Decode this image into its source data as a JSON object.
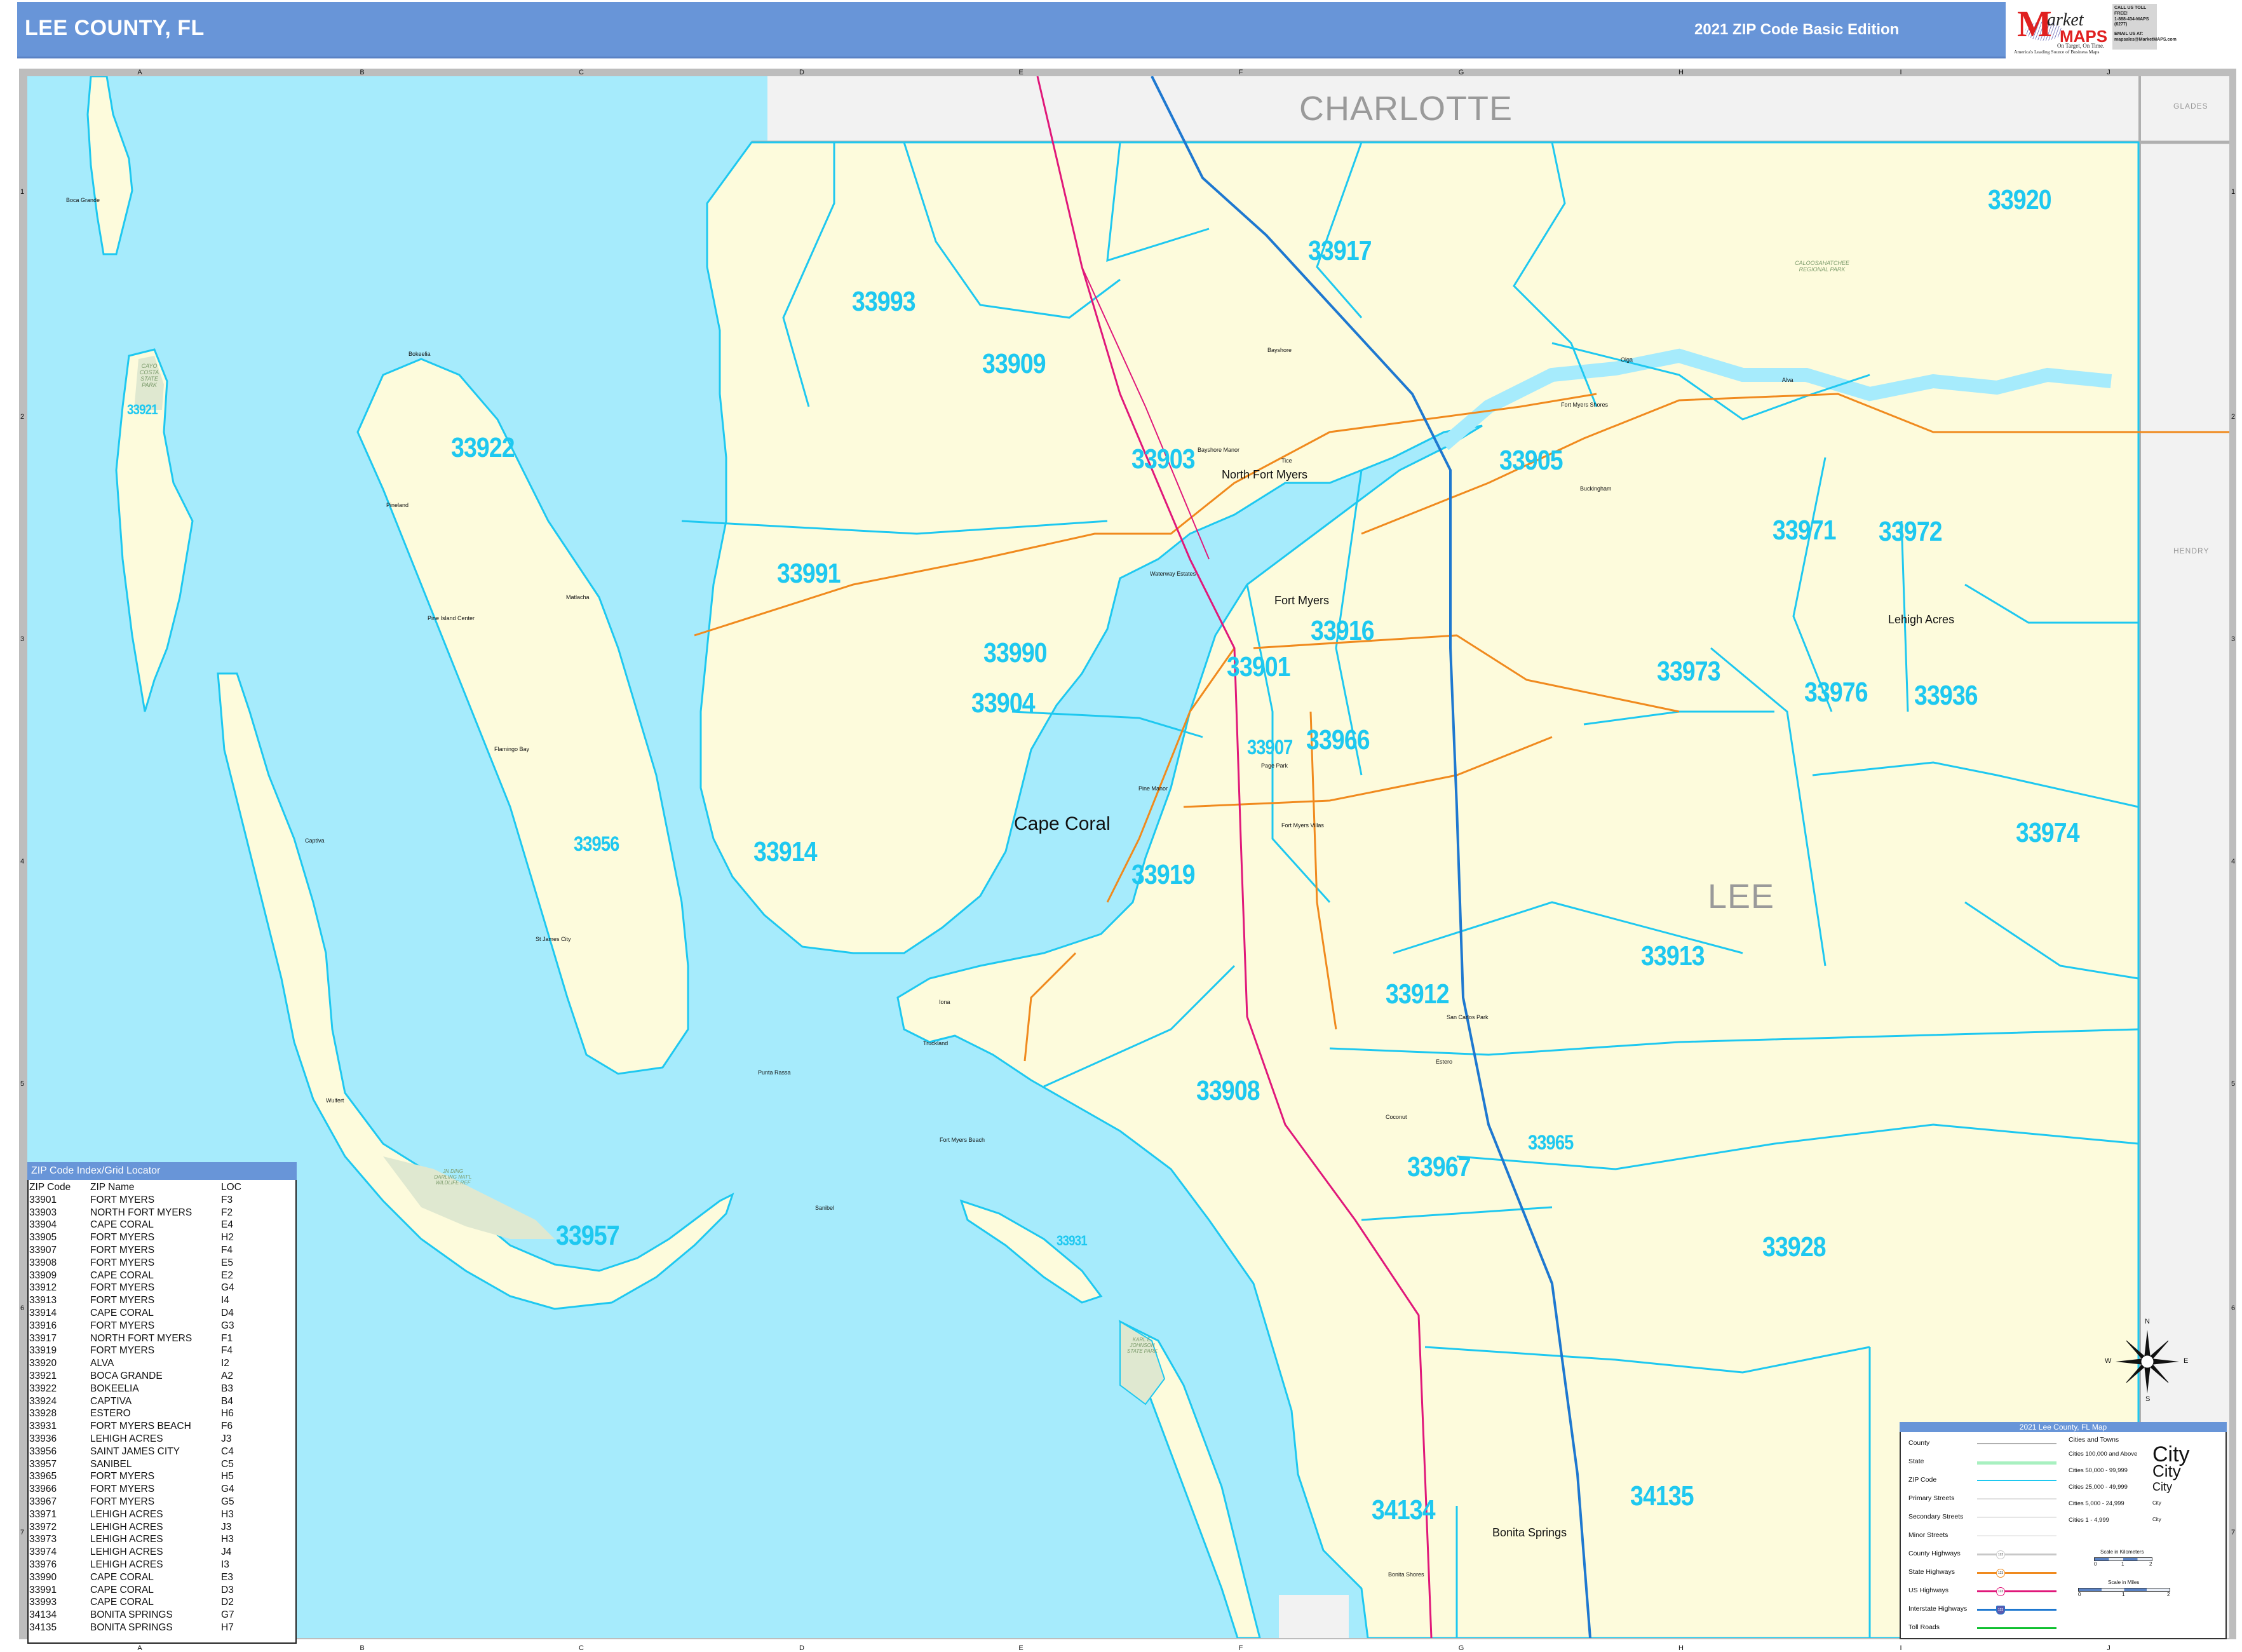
{
  "header": {
    "title": "LEE COUNTY, FL",
    "edition": "2021 ZIP Code Basic Edition"
  },
  "logo": {
    "m": "M",
    "arket": "arket",
    "maps": "MAPS",
    "tagline": "On Target, On Time.",
    "slogan": "America's Leading Source of Business Maps",
    "contact_line1": "CALL US TOLL FREE!",
    "contact_line2": "1-888-434-MAPS (6277)",
    "contact_line3": "EMAIL US AT:",
    "contact_line4": "mapsales@MarketMAPS.com"
  },
  "grid": {
    "columns": [
      "A",
      "B",
      "C",
      "D",
      "E",
      "F",
      "G",
      "H",
      "I",
      "J"
    ],
    "rows": [
      "1",
      "2",
      "3",
      "4",
      "5",
      "6",
      "7"
    ]
  },
  "counties": {
    "main": "LEE",
    "north": "CHARLOTTE",
    "northeast": "GLADES",
    "east": "HENDRY"
  },
  "zip_labels": [
    {
      "zip": "33920"
    },
    {
      "zip": "33917"
    },
    {
      "zip": "33993"
    },
    {
      "zip": "33909"
    },
    {
      "zip": "33922"
    },
    {
      "zip": "33903"
    },
    {
      "zip": "33905"
    },
    {
      "zip": "33971"
    },
    {
      "zip": "33972"
    },
    {
      "zip": "33991"
    },
    {
      "zip": "33916"
    },
    {
      "zip": "33990"
    },
    {
      "zip": "33901"
    },
    {
      "zip": "33973"
    },
    {
      "zip": "33976"
    },
    {
      "zip": "33936"
    },
    {
      "zip": "33904"
    },
    {
      "zip": "33907"
    },
    {
      "zip": "33966"
    },
    {
      "zip": "33956"
    },
    {
      "zip": "33914"
    },
    {
      "zip": "33919"
    },
    {
      "zip": "33974"
    },
    {
      "zip": "33913"
    },
    {
      "zip": "33912"
    },
    {
      "zip": "33908"
    },
    {
      "zip": "33965"
    },
    {
      "zip": "33967"
    },
    {
      "zip": "33957"
    },
    {
      "zip": "33928"
    },
    {
      "zip": "34134"
    },
    {
      "zip": "34135"
    },
    {
      "zip": "33921"
    },
    {
      "zip": "33931"
    }
  ],
  "places": {
    "cape_coral": "Cape Coral",
    "fort_myers": "Fort Myers",
    "north_fort_myers": "North Fort Myers",
    "lehigh_acres": "Lehigh Acres",
    "bonita_springs": "Bonita Springs",
    "boca_grande": "Boca Grande",
    "bokeelia": "Bokeelia",
    "pineland": "Pineland",
    "matlacha": "Matlacha",
    "pine_island_center": "Pine Island Center",
    "flamingo_bay": "Flamingo Bay",
    "captiva": "Captiva",
    "st_james_city": "St James City",
    "wulfert": "Wulfert",
    "sanibel": "Sanibel",
    "punta_rassa": "Punta Rassa",
    "truckland": "Truckland",
    "iona": "Iona",
    "fort_myers_beach": "Fort Myers Beach",
    "bayshore": "Bayshore",
    "bayshore_manor": "Bayshore Manor",
    "tice": "Tice",
    "fort_myers_shores": "Fort Myers Shores",
    "olga": "Olga",
    "alva": "Alva",
    "buckingham": "Buckingham",
    "waterway_estates": "Waterway Estates",
    "page_park": "Page Park",
    "pine_manor": "Pine Manor",
    "fort_myers_villas": "Fort Myers Villas",
    "san_carlos_park": "San Carlos Park",
    "estero": "Estero",
    "coconut": "Coconut",
    "bonita_shores": "Bonita Shores"
  },
  "parks": {
    "cayo_costa": "CAYO COSTA STATE PARK",
    "caloosahatchee": "CALOOSAHATCHEE REGIONAL PARK",
    "ding_darling": "JN DING DARLING NAT'L WILDLIFE REF",
    "koreshan": "KARL E. JOHNSON STATE PARK"
  },
  "zip_index": {
    "title": "ZIP Code Index/Grid Locator",
    "headers": [
      "ZIP Code",
      "ZIP Name",
      "LOC"
    ],
    "rows": [
      [
        "33901",
        "FORT MYERS",
        "F3"
      ],
      [
        "33903",
        "NORTH FORT MYERS",
        "F2"
      ],
      [
        "33904",
        "CAPE CORAL",
        "E4"
      ],
      [
        "33905",
        "FORT MYERS",
        "H2"
      ],
      [
        "33907",
        "FORT MYERS",
        "F4"
      ],
      [
        "33908",
        "FORT MYERS",
        "E5"
      ],
      [
        "33909",
        "CAPE CORAL",
        "E2"
      ],
      [
        "33912",
        "FORT MYERS",
        "G4"
      ],
      [
        "33913",
        "FORT MYERS",
        "I4"
      ],
      [
        "33914",
        "CAPE CORAL",
        "D4"
      ],
      [
        "33916",
        "FORT MYERS",
        "G3"
      ],
      [
        "33917",
        "NORTH FORT MYERS",
        "F1"
      ],
      [
        "33919",
        "FORT MYERS",
        "F4"
      ],
      [
        "33920",
        "ALVA",
        "I2"
      ],
      [
        "33921",
        "BOCA GRANDE",
        "A2"
      ],
      [
        "33922",
        "BOKEELIA",
        "B3"
      ],
      [
        "33924",
        "CAPTIVA",
        "B4"
      ],
      [
        "33928",
        "ESTERO",
        "H6"
      ],
      [
        "33931",
        "FORT MYERS BEACH",
        "F6"
      ],
      [
        "33936",
        "LEHIGH ACRES",
        "J3"
      ],
      [
        "33956",
        "SAINT JAMES CITY",
        "C4"
      ],
      [
        "33957",
        "SANIBEL",
        "C5"
      ],
      [
        "33965",
        "FORT MYERS",
        "H5"
      ],
      [
        "33966",
        "FORT MYERS",
        "G4"
      ],
      [
        "33967",
        "FORT MYERS",
        "G5"
      ],
      [
        "33971",
        "LEHIGH ACRES",
        "H3"
      ],
      [
        "33972",
        "LEHIGH ACRES",
        "J3"
      ],
      [
        "33973",
        "LEHIGH ACRES",
        "H3"
      ],
      [
        "33974",
        "LEHIGH ACRES",
        "J4"
      ],
      [
        "33976",
        "LEHIGH ACRES",
        "I3"
      ],
      [
        "33990",
        "CAPE CORAL",
        "E3"
      ],
      [
        "33991",
        "CAPE CORAL",
        "D3"
      ],
      [
        "33993",
        "CAPE CORAL",
        "D2"
      ],
      [
        "34134",
        "BONITA SPRINGS",
        "G7"
      ],
      [
        "34135",
        "BONITA SPRINGS",
        "H7"
      ]
    ]
  },
  "legend": {
    "title": "2021 Lee County, FL Map",
    "items": [
      {
        "label": "County",
        "color": "#b0b0b0"
      },
      {
        "label": "State",
        "color": "#a8f0c0"
      },
      {
        "label": "ZIP Code",
        "color": "#1ec8f0"
      },
      {
        "label": "Primary Streets",
        "color": "#e0e0e0"
      },
      {
        "label": "Secondary Streets",
        "color": "#e6e6e6"
      },
      {
        "label": "Minor Streets",
        "color": "#ececec"
      },
      {
        "label": "County Highways",
        "color": "#c8c8c8"
      },
      {
        "label": "State Highways",
        "color": "#f08a1e"
      },
      {
        "label": "US Highways",
        "color": "#e0187a"
      },
      {
        "label": "Interstate Highways",
        "color": "#1e78d0"
      },
      {
        "label": "Toll Roads",
        "color": "#10c030"
      }
    ],
    "shield_text": "123",
    "cities_title": "Cities and Towns",
    "city_categories": [
      "Cities 100,000 and Above",
      "Cities 50,000 - 99,999",
      "Cities 25,000 - 49,999",
      "Cities 5,000 - 24,999",
      "Cities 1 - 4,999"
    ],
    "city_sample": "City",
    "scale_km_title": "Scale in Kilometers",
    "scale_mi_title": "Scale in Miles",
    "scale_ticks": [
      "0",
      "1",
      "2"
    ]
  },
  "compass": {
    "n": "N",
    "s": "S",
    "e": "E",
    "w": "W"
  },
  "colors": {
    "water": "#a6ebfc",
    "land": "#fdfbdc",
    "outside_county": "#f2f2f2",
    "zip_boundary": "#1ec8f0",
    "zip_text": "#1ec8f0",
    "banner": "#6895d8",
    "us_highway": "#e0187a",
    "interstate": "#1e78d0",
    "state_highway": "#f08a1e"
  }
}
